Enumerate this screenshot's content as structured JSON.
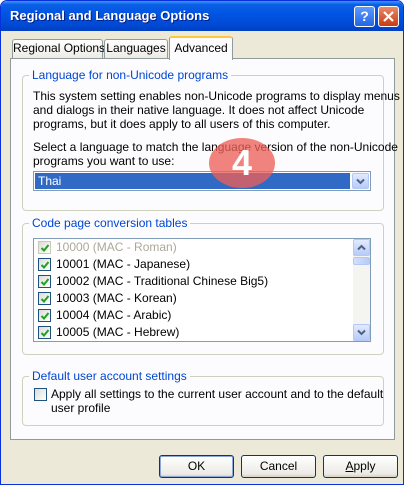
{
  "window": {
    "title": "Regional and Language Options",
    "help_icon": "question-mark-icon",
    "close_icon": "close-icon"
  },
  "tabs": [
    {
      "label": "Regional Options",
      "active": false
    },
    {
      "label": "Languages",
      "active": false
    },
    {
      "label": "Advanced",
      "active": true
    }
  ],
  "non_unicode": {
    "group_title": "Language for non-Unicode programs",
    "description_lines": [
      "This system setting enables non-Unicode programs to display menus",
      "and dialogs in their native language. It does not affect Unicode",
      "programs, but it does apply to all users of this computer."
    ],
    "select_prompt_lines": [
      "Select a language to match the language version of the non-Unicode",
      "programs you want to use:"
    ],
    "selected_language": "Thai"
  },
  "code_pages": {
    "group_title": "Code page conversion tables",
    "items": [
      {
        "label": "10000 (MAC - Roman)",
        "checked": true,
        "disabled": true
      },
      {
        "label": "10001 (MAC - Japanese)",
        "checked": true,
        "disabled": false
      },
      {
        "label": "10002 (MAC - Traditional Chinese Big5)",
        "checked": true,
        "disabled": false
      },
      {
        "label": "10003 (MAC - Korean)",
        "checked": true,
        "disabled": false
      },
      {
        "label": "10004 (MAC - Arabic)",
        "checked": true,
        "disabled": false
      },
      {
        "label": "10005 (MAC - Hebrew)",
        "checked": true,
        "disabled": false
      }
    ]
  },
  "default_user": {
    "group_title": "Default user account settings",
    "checkbox_label_lines": [
      "Apply all settings to the current user account and to the default",
      "user profile"
    ],
    "checked": false
  },
  "buttons": {
    "ok": "OK",
    "cancel": "Cancel",
    "apply_first": "A",
    "apply_rest": "pply"
  },
  "overlay": {
    "step_number": "4"
  },
  "colors": {
    "title_bar": "#0054e3",
    "group_title": "#0046d5",
    "selection": "#316ac5",
    "marker": "#ec6058",
    "check": "#21a121"
  }
}
